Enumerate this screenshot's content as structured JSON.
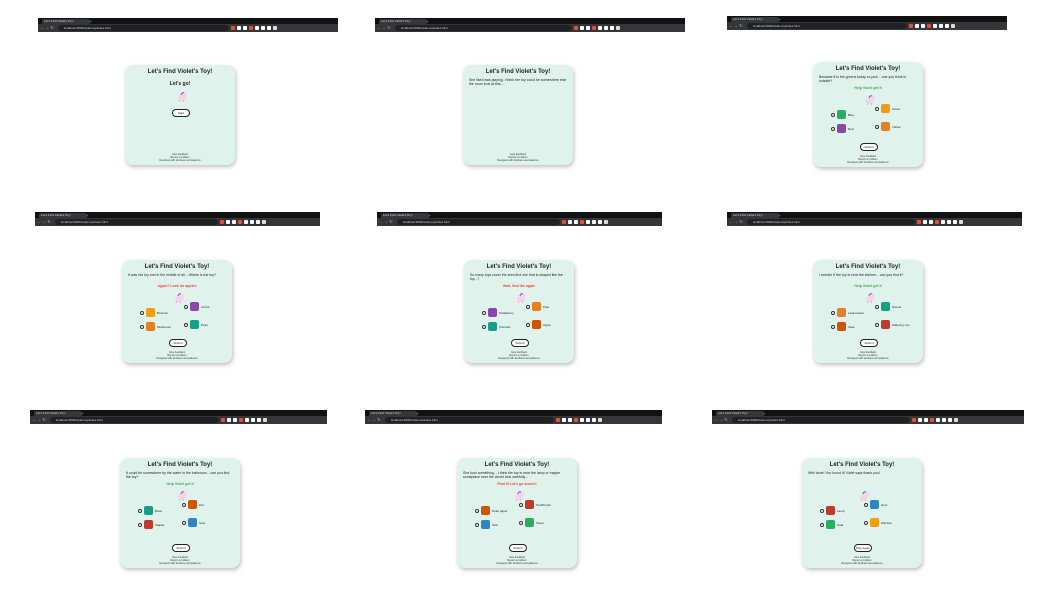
{
  "browser": {
    "tab_title": "Let's Find Violet's Toy!",
    "url": "localhost:3000/violet-toy/index.html"
  },
  "page": {
    "title": "Let's Find Violet's Toy!",
    "footer_line1": "Give feedback",
    "footer_line2": "Report a problem",
    "footer_line3": "Designed with kindness and patience"
  },
  "panels": [
    {
      "title": "Let's Find Violet's Toy!",
      "subtitle": "Let's go!",
      "button": "Start",
      "choices": []
    },
    {
      "title": "Let's Find Violet's Toy!",
      "subtitle": "She liked was playing. I think her toy could be somewhere else the room look at this...",
      "button": "",
      "choices": []
    },
    {
      "title": "Let's Find Violet's Toy!",
      "subtitle": "Because it is the greens today so pick... one you think is outside?",
      "prompt": "Help Violet get it",
      "button": "Submit",
      "choices": []
    },
    {
      "title": "Let's Find Violet's Toy!",
      "subtitle": "It was her toy and in the middle of all... Where is the toy?",
      "prompt": "Apple? Look for apples",
      "button": "Submit",
      "choices": []
    },
    {
      "title": "Let's Find Violet's Toy!",
      "subtitle": "So many toys cover the area find one that is shaped like the toy...?",
      "prompt": "Wait, find the apple",
      "button": "Submit",
      "choices": []
    },
    {
      "title": "Let's Find Violet's Toy!",
      "subtitle": "I wonder if the toy is near the kitchen... can you find it?",
      "prompt": "Help Violet get it",
      "button": "Submit",
      "choices": []
    },
    {
      "title": "Let's Find Violet's Toy!",
      "subtitle": "It could be somewhere by the water in the bathroom... can you find the toy?",
      "prompt": "Help Violet get it",
      "button": "Submit",
      "choices": []
    },
    {
      "title": "Let's Find Violet's Toy!",
      "subtitle": "She took something... I think the toy is near the lamp or maybe someplace near the closet look carefully...",
      "prompt": "Find it! Let's go search!",
      "button": "Submit",
      "choices": []
    },
    {
      "title": "Let's Find Violet's Toy!",
      "subtitle": "Well done! You found it! Violet says thank you!",
      "button": "Play again",
      "choices": []
    }
  ],
  "choice_labels": {
    "p2": [
      "Blue",
      "Green",
      "Red",
      "Yellow"
    ],
    "p3": [
      "Broccoli",
      "Carrot",
      "Mushroom",
      "Peas"
    ],
    "p4": [
      "Strawberry",
      "Pear",
      "Pumpkin",
      "Apple"
    ],
    "p5": [
      "Lawnmower",
      "Shovel",
      "Vase",
      "Watering can"
    ],
    "p6": [
      "Book",
      "Pen",
      "Stapler",
      "Glue"
    ],
    "p7": [
      "Toilet paper",
      "Toothbrush",
      "Sink",
      "Towel"
    ],
    "p8": [
      "Lamp",
      "Door",
      "Sofa",
      "Window"
    ]
  },
  "colors": {
    "card_bg": "#dff3ec",
    "prompt_red": "#e74c3c",
    "prompt_green": "#4ca454"
  }
}
